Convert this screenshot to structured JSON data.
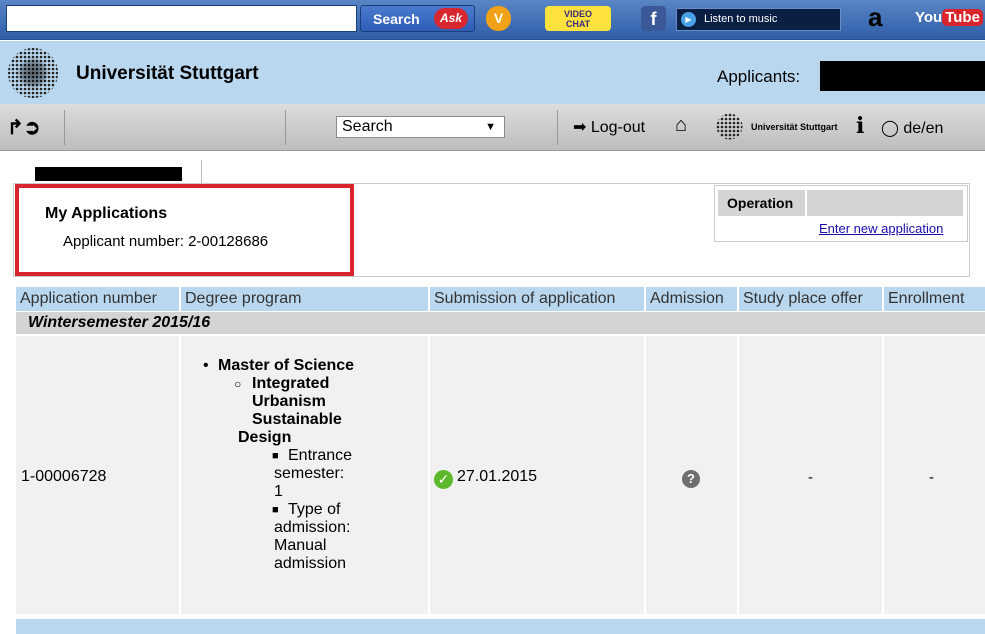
{
  "toolbar": {
    "search_input_value": "",
    "search_button_label": "Search",
    "ask_logo": "Ask",
    "v_icon": "V",
    "videochat_label_1": "VIDEO",
    "videochat_label_2": "CHAT",
    "facebook_icon": "f",
    "music_label": "Listen to music",
    "amazon_icon": "a",
    "youtube_label_1": "You",
    "youtube_label_2": "Tube"
  },
  "header": {
    "university_name": "Universität Stuttgart",
    "applicants_label": "Applicants:"
  },
  "nav": {
    "search_select_value": "Search",
    "logout_label": "Log-out",
    "small_university_name": "Universität Stuttgart",
    "info_icon": "i",
    "language_label": "de/en"
  },
  "panel": {
    "title": "My Applications",
    "applicant_number": "Applicant number: 2-00128686",
    "operation_header": "Operation",
    "operation_link": "Enter new application"
  },
  "table": {
    "columns": [
      "Application number",
      "Degree program",
      "Submission of application",
      "Admission",
      "Study place offer",
      "Enrollment"
    ],
    "semester": "Wintersemester 2015/16",
    "row": {
      "application_number": "1-00006728",
      "degree": "Master of Science",
      "program_lines": [
        "Integrated",
        "Urbanism",
        "Sustainable",
        "Design"
      ],
      "details": [
        [
          "Entrance",
          "semester:",
          "1"
        ],
        [
          "Type of",
          "admission:",
          "Manual",
          "admission"
        ]
      ],
      "submission_date": "27.01.2015",
      "admission_status": "unknown",
      "study_place_offer": "-",
      "enrollment": "-"
    }
  },
  "colors": {
    "header_blue": "#b9d7ef",
    "highlight_red": "#d9232d",
    "success_green": "#5db82b"
  }
}
